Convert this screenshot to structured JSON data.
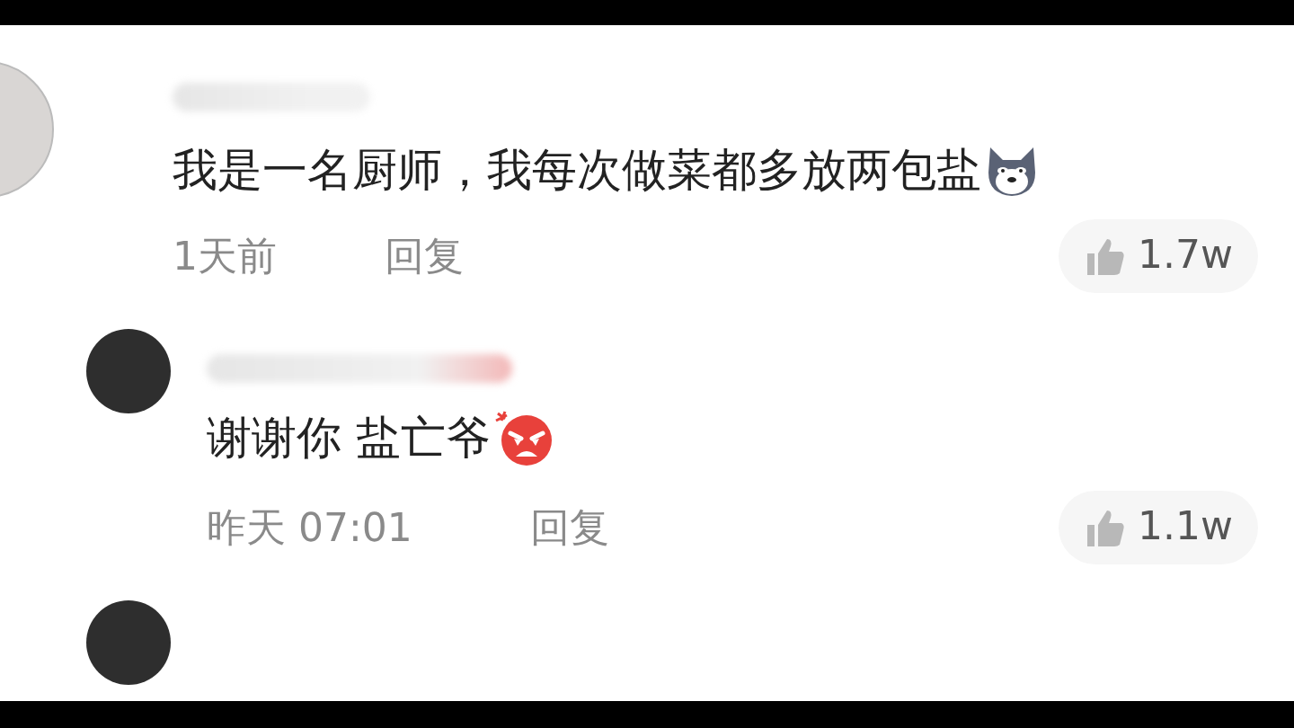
{
  "comments": [
    {
      "text": "我是一名厨师，我每次做菜都多放两包盐",
      "emoji": {
        "kind": "wolf"
      },
      "time": "1天前",
      "reply_label": "回复",
      "likes": "1.7w",
      "children": [
        {
          "text": "谢谢你 盐亡爷",
          "emoji": {
            "kind": "angry"
          },
          "time": "昨天 07:01",
          "reply_label": "回复",
          "likes": "1.1w"
        }
      ]
    }
  ]
}
